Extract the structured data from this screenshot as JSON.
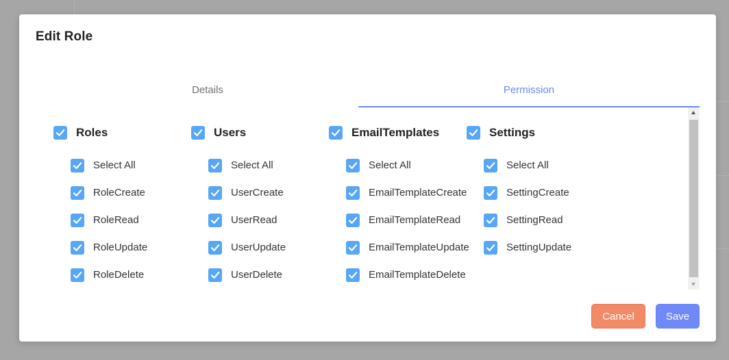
{
  "dialog": {
    "title": "Edit Role"
  },
  "tabs": [
    {
      "label": "Details",
      "active": false
    },
    {
      "label": "Permission",
      "active": true
    }
  ],
  "groups": [
    {
      "name": "Roles",
      "checked": true,
      "items": [
        {
          "label": "Select All",
          "checked": true
        },
        {
          "label": "RoleCreate",
          "checked": true
        },
        {
          "label": "RoleRead",
          "checked": true
        },
        {
          "label": "RoleUpdate",
          "checked": true
        },
        {
          "label": "RoleDelete",
          "checked": true
        }
      ]
    },
    {
      "name": "Users",
      "checked": true,
      "items": [
        {
          "label": "Select All",
          "checked": true
        },
        {
          "label": "UserCreate",
          "checked": true
        },
        {
          "label": "UserRead",
          "checked": true
        },
        {
          "label": "UserUpdate",
          "checked": true
        },
        {
          "label": "UserDelete",
          "checked": true
        }
      ]
    },
    {
      "name": "EmailTemplates",
      "checked": true,
      "items": [
        {
          "label": "Select All",
          "checked": true
        },
        {
          "label": "EmailTemplateCreate",
          "checked": true
        },
        {
          "label": "EmailTemplateRead",
          "checked": true
        },
        {
          "label": "EmailTemplateUpdate",
          "checked": true
        },
        {
          "label": "EmailTemplateDelete",
          "checked": true
        }
      ]
    },
    {
      "name": "Settings",
      "checked": true,
      "items": [
        {
          "label": "Select All",
          "checked": true
        },
        {
          "label": "SettingCreate",
          "checked": true
        },
        {
          "label": "SettingRead",
          "checked": true
        },
        {
          "label": "SettingUpdate",
          "checked": true
        }
      ]
    }
  ],
  "buttons": {
    "cancel": "Cancel",
    "save": "Save"
  },
  "colors": {
    "accent": "#6c87f0",
    "checkbox": "#58a6f6",
    "cancel": "#f28967",
    "save": "#6f89f7"
  },
  "icons": {
    "checkbox_mark": "check-icon"
  }
}
